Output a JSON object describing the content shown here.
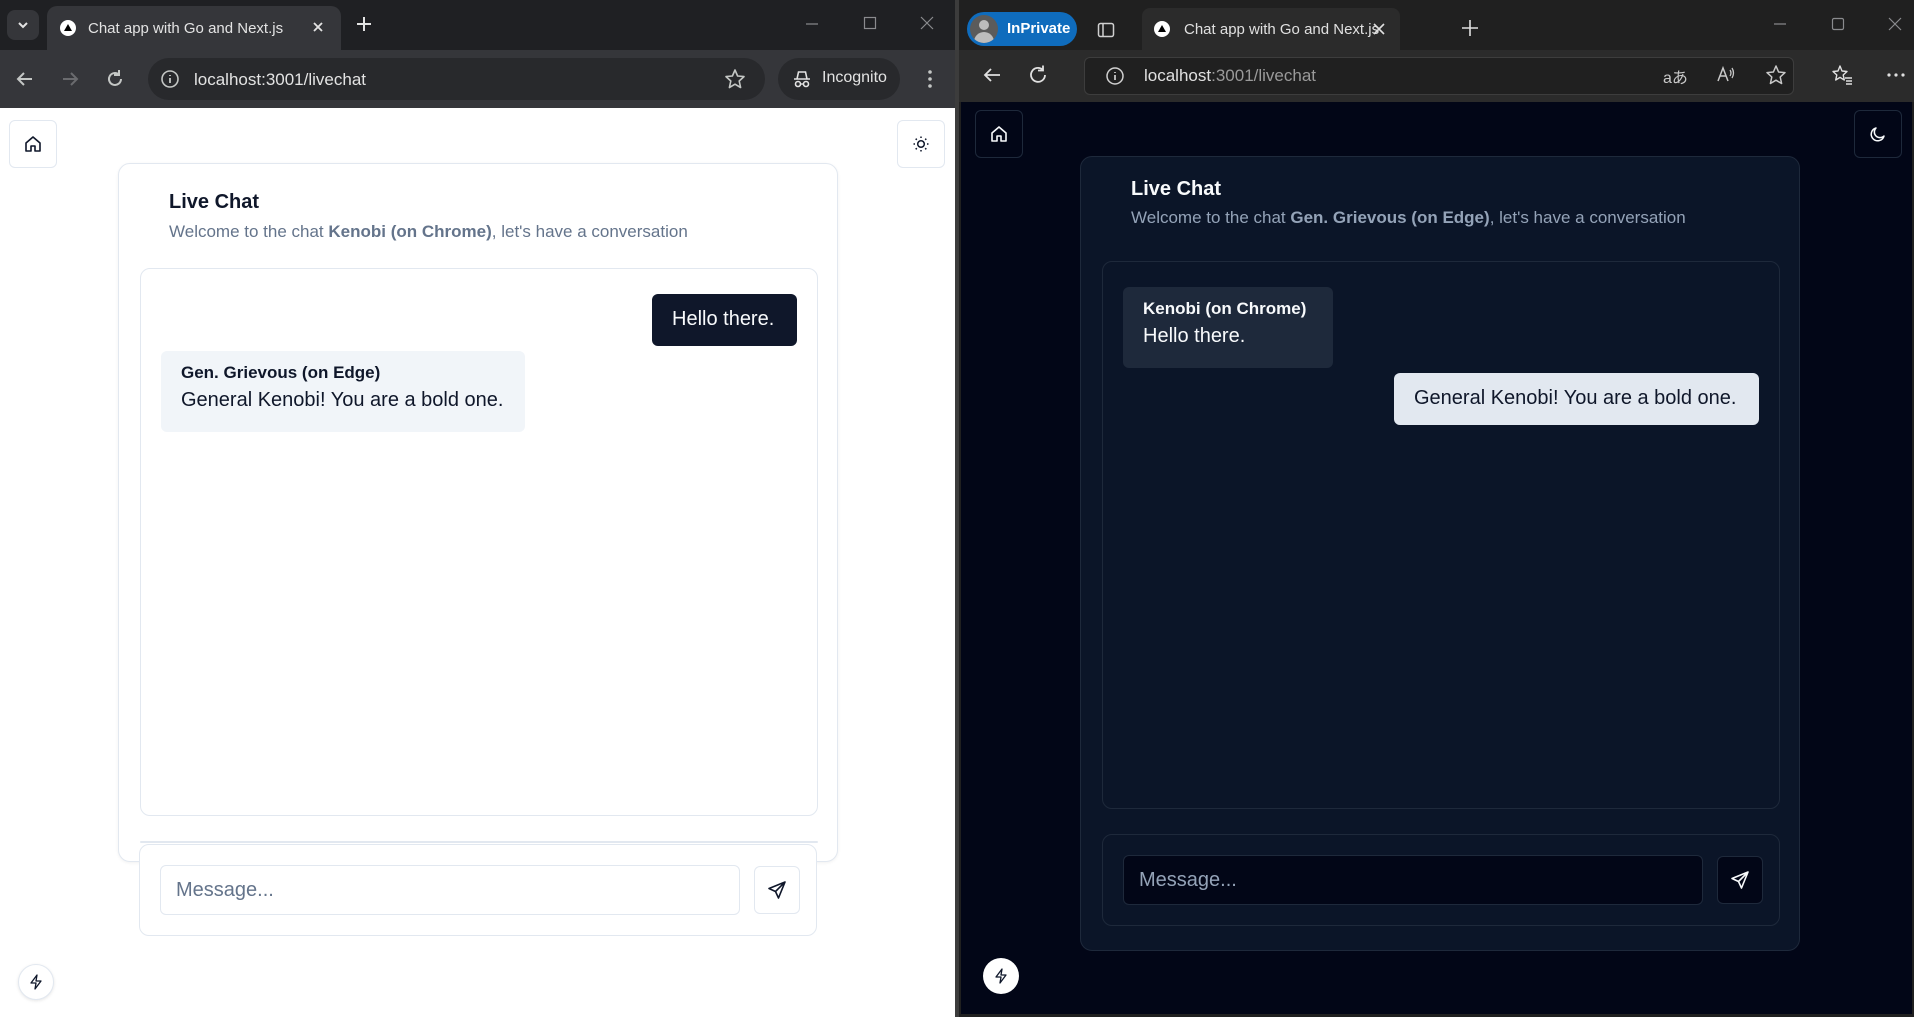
{
  "chrome": {
    "tab_title": "Chat app with Go and Next.js",
    "url": "localhost:3001/livechat",
    "incognito_label": "Incognito",
    "page": {
      "title": "Live Chat",
      "subtitle_prefix": "Welcome to the chat ",
      "username": "Kenobi (on Chrome)",
      "subtitle_suffix": ", let's have a conversation",
      "messages": [
        {
          "sender": "",
          "text": "Hello there.",
          "own": true
        },
        {
          "sender": "Gen. Grievous (on Edge)",
          "text": "General Kenobi! You are a bold one.",
          "own": false
        }
      ],
      "input_placeholder": "Message...",
      "theme_icon": "sun-icon"
    }
  },
  "edge": {
    "inprivate_label": "InPrivate",
    "tab_title": "Chat app with Go and Next.js",
    "url_host": "localhost",
    "url_rest": ":3001/livechat",
    "page": {
      "title": "Live Chat",
      "subtitle_prefix": "Welcome to the chat ",
      "username": "Gen. Grievous (on Edge)",
      "subtitle_suffix": ", let's have a conversation",
      "messages": [
        {
          "sender": "Kenobi (on Chrome)",
          "text": "Hello there.",
          "own": false
        },
        {
          "sender": "",
          "text": "General Kenobi! You are a bold one.",
          "own": true
        }
      ],
      "input_placeholder": "Message...",
      "theme_icon": "moon-icon"
    }
  }
}
